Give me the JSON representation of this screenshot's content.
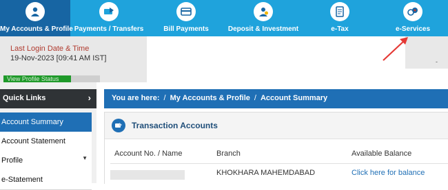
{
  "nav": {
    "items": [
      {
        "label": "My Accounts & Profile",
        "icon": "user-icon"
      },
      {
        "label": "Payments / Transfers",
        "icon": "money-transfer-icon"
      },
      {
        "label": "Bill Payments",
        "icon": "bill-card-icon"
      },
      {
        "label": "Deposit & Investment",
        "icon": "investment-icon"
      },
      {
        "label": "e-Tax",
        "icon": "tax-document-icon"
      },
      {
        "label": "e-Services",
        "icon": "e-services-icon"
      }
    ],
    "active_index": 0
  },
  "login": {
    "title": "Last Login Date & Time",
    "datetime": "19-Nov-2023 [09:41 AM IST]",
    "profile_status_label": "View Profile Status",
    "profile_progress": 0.7
  },
  "header_extra": {
    "dash": "-"
  },
  "sidebar": {
    "quick_links_label": "Quick Links",
    "quick_links_icon": "chevron-right-icon",
    "items": [
      {
        "label": "Account Summary"
      },
      {
        "label": "Account Statement"
      },
      {
        "label": "Profile"
      },
      {
        "label": "e-Statement"
      }
    ]
  },
  "breadcrumb": {
    "prefix": "You are here:",
    "items": [
      "My Accounts & Profile",
      "Account Summary"
    ],
    "separator": "/"
  },
  "transactions": {
    "title": "Transaction Accounts",
    "columns": [
      "Account No. / Name",
      "Branch",
      "Available Balance"
    ],
    "rows": [
      {
        "branch": "KHOKHARA MAHEMDABAD",
        "balance_link": "Click here for balance"
      }
    ]
  },
  "colors": {
    "nav_bg": "#1fa3dc",
    "nav_active": "#1765a3",
    "primary_blue": "#1f6fb5",
    "login_title": "#b03a2e",
    "progress_green": "#1f9a2a",
    "arrow_red": "#e53935"
  }
}
